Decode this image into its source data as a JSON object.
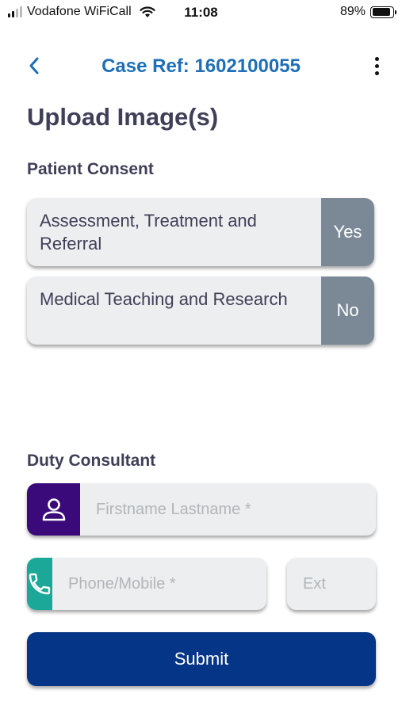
{
  "status_bar": {
    "carrier": "Vodafone WiFiCall",
    "time": "11:08",
    "battery_percent": "89%",
    "battery_level": 0.89
  },
  "header": {
    "title": "Case Ref: 1602100055",
    "back_icon": "chevron-left-icon",
    "more_icon": "more-vertical-icon"
  },
  "page": {
    "title": "Upload Image(s)"
  },
  "consent": {
    "section_label": "Patient Consent",
    "items": [
      {
        "label": "Assessment, Treatment and Referral",
        "value": "Yes"
      },
      {
        "label": "Medical Teaching and Research",
        "value": "No"
      }
    ]
  },
  "consultant": {
    "section_label": "Duty Consultant",
    "name_placeholder": "Firstname Lastname *",
    "phone_placeholder": "Phone/Mobile *",
    "ext_placeholder": "Ext",
    "person_icon": "person-icon",
    "phone_icon": "phone-icon"
  },
  "submit_label": "Submit",
  "colors": {
    "accent_blue": "#1e6fb7",
    "person_icon_bg": "#3b0a7a",
    "phone_icon_bg": "#1ba898",
    "consent_value_bg": "#7b8996",
    "submit_bg": "#053586"
  }
}
